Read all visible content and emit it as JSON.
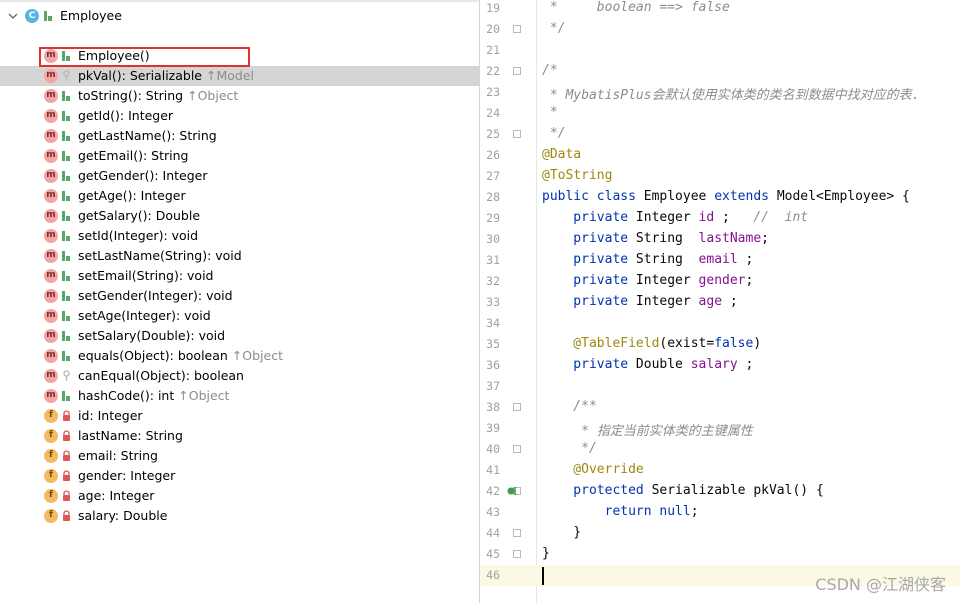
{
  "structure": {
    "root": {
      "label": "Employee",
      "icon": "class-icon"
    },
    "members": [
      {
        "kind": "method",
        "name": "Employee()",
        "suffix": "",
        "access": "public"
      },
      {
        "kind": "method",
        "name": "pkVal(): Serializable",
        "suffix": "↑Model",
        "access": "protected",
        "selected": true
      },
      {
        "kind": "method",
        "name": "toString(): String",
        "suffix": "↑Object",
        "access": "public"
      },
      {
        "kind": "method",
        "name": "getId(): Integer",
        "suffix": "",
        "access": "public"
      },
      {
        "kind": "method",
        "name": "getLastName(): String",
        "suffix": "",
        "access": "public"
      },
      {
        "kind": "method",
        "name": "getEmail(): String",
        "suffix": "",
        "access": "public"
      },
      {
        "kind": "method",
        "name": "getGender(): Integer",
        "suffix": "",
        "access": "public"
      },
      {
        "kind": "method",
        "name": "getAge(): Integer",
        "suffix": "",
        "access": "public"
      },
      {
        "kind": "method",
        "name": "getSalary(): Double",
        "suffix": "",
        "access": "public"
      },
      {
        "kind": "method",
        "name": "setId(Integer): void",
        "suffix": "",
        "access": "public"
      },
      {
        "kind": "method",
        "name": "setLastName(String): void",
        "suffix": "",
        "access": "public"
      },
      {
        "kind": "method",
        "name": "setEmail(String): void",
        "suffix": "",
        "access": "public"
      },
      {
        "kind": "method",
        "name": "setGender(Integer): void",
        "suffix": "",
        "access": "public"
      },
      {
        "kind": "method",
        "name": "setAge(Integer): void",
        "suffix": "",
        "access": "public"
      },
      {
        "kind": "method",
        "name": "setSalary(Double): void",
        "suffix": "",
        "access": "public"
      },
      {
        "kind": "method",
        "name": "equals(Object): boolean",
        "suffix": "↑Object",
        "access": "public"
      },
      {
        "kind": "method",
        "name": "canEqual(Object): boolean",
        "suffix": "",
        "access": "protected"
      },
      {
        "kind": "method",
        "name": "hashCode(): int",
        "suffix": "↑Object",
        "access": "public"
      },
      {
        "kind": "field",
        "name": "id: Integer",
        "suffix": "",
        "access": "private"
      },
      {
        "kind": "field",
        "name": "lastName: String",
        "suffix": "",
        "access": "private"
      },
      {
        "kind": "field",
        "name": "email: String",
        "suffix": "",
        "access": "private"
      },
      {
        "kind": "field",
        "name": "gender: Integer",
        "suffix": "",
        "access": "private"
      },
      {
        "kind": "field",
        "name": "age: Integer",
        "suffix": "",
        "access": "private"
      },
      {
        "kind": "field",
        "name": "salary: Double",
        "suffix": "",
        "access": "private"
      }
    ]
  },
  "editor": {
    "lines": [
      {
        "n": "19",
        "fold": false,
        "t": [
          [
            "cm",
            " *     boolean ==> false"
          ]
        ]
      },
      {
        "n": "20",
        "fold": true,
        "t": [
          [
            "cm",
            " */"
          ]
        ]
      },
      {
        "n": "21",
        "fold": false,
        "t": []
      },
      {
        "n": "22",
        "fold": true,
        "t": [
          [
            "cm",
            "/*"
          ]
        ]
      },
      {
        "n": "23",
        "fold": false,
        "t": [
          [
            "cm",
            " * MybatisPlus会默认使用实体类的类名到数据中找对应的表."
          ]
        ]
      },
      {
        "n": "24",
        "fold": false,
        "t": [
          [
            "cm",
            " *"
          ]
        ]
      },
      {
        "n": "25",
        "fold": true,
        "t": [
          [
            "cm",
            " */"
          ]
        ]
      },
      {
        "n": "26",
        "fold": false,
        "t": [
          [
            "an",
            "@Data"
          ]
        ]
      },
      {
        "n": "27",
        "fold": false,
        "t": [
          [
            "an",
            "@ToString"
          ]
        ]
      },
      {
        "n": "28",
        "fold": false,
        "t": [
          [
            "kw",
            "public class "
          ],
          [
            "",
            "Employee "
          ],
          [
            "kw",
            "extends "
          ],
          [
            "",
            "Model<Employee> {"
          ]
        ]
      },
      {
        "n": "29",
        "fold": false,
        "t": [
          [
            "kw",
            "    private "
          ],
          [
            "",
            "Integer "
          ],
          [
            "fd",
            "id"
          ],
          [
            "",
            " ;   "
          ],
          [
            "cm",
            "//  int"
          ]
        ]
      },
      {
        "n": "30",
        "fold": false,
        "t": [
          [
            "kw",
            "    private "
          ],
          [
            "",
            "String  "
          ],
          [
            "fd",
            "lastName"
          ],
          [
            "",
            ";"
          ]
        ]
      },
      {
        "n": "31",
        "fold": false,
        "t": [
          [
            "kw",
            "    private "
          ],
          [
            "",
            "String  "
          ],
          [
            "fd",
            "email"
          ],
          [
            "",
            " ;"
          ]
        ]
      },
      {
        "n": "32",
        "fold": false,
        "t": [
          [
            "kw",
            "    private "
          ],
          [
            "",
            "Integer "
          ],
          [
            "fd",
            "gender"
          ],
          [
            "",
            ";"
          ]
        ]
      },
      {
        "n": "33",
        "fold": false,
        "t": [
          [
            "kw",
            "    private "
          ],
          [
            "",
            "Integer "
          ],
          [
            "fd",
            "age"
          ],
          [
            "",
            " ;"
          ]
        ]
      },
      {
        "n": "34",
        "fold": false,
        "t": []
      },
      {
        "n": "35",
        "fold": false,
        "t": [
          [
            "an",
            "    @TableField"
          ],
          [
            "",
            "(exist="
          ],
          [
            "kw",
            "false"
          ],
          [
            "",
            ")"
          ]
        ]
      },
      {
        "n": "36",
        "fold": false,
        "t": [
          [
            "kw",
            "    private "
          ],
          [
            "",
            "Double "
          ],
          [
            "fd",
            "salary"
          ],
          [
            "",
            " ;"
          ]
        ]
      },
      {
        "n": "37",
        "fold": false,
        "t": []
      },
      {
        "n": "38",
        "fold": true,
        "t": [
          [
            "cm",
            "    /**"
          ]
        ]
      },
      {
        "n": "39",
        "fold": false,
        "t": [
          [
            "cm",
            "     * 指定当前实体类的主键属性"
          ]
        ]
      },
      {
        "n": "40",
        "fold": true,
        "t": [
          [
            "cm",
            "     */"
          ]
        ]
      },
      {
        "n": "41",
        "fold": false,
        "t": [
          [
            "an",
            "    @Override"
          ]
        ]
      },
      {
        "n": "42",
        "fold": true,
        "t": [
          [
            "kw",
            "    protected "
          ],
          [
            "",
            "Serializable pkVal() {"
          ]
        ]
      },
      {
        "n": "43",
        "fold": false,
        "t": [
          [
            "kw",
            "        return null"
          ],
          [
            "",
            ";"
          ]
        ]
      },
      {
        "n": "44",
        "fold": true,
        "t": [
          [
            "",
            "    }"
          ]
        ]
      },
      {
        "n": "45",
        "fold": true,
        "t": [
          [
            "",
            "}"
          ]
        ]
      },
      {
        "n": "46",
        "fold": false,
        "t": [],
        "current": true
      }
    ]
  },
  "watermark": "CSDN @江湖侠客",
  "colors": {
    "keyword": "#0033b3",
    "comment": "#8c8c8c",
    "annotation": "#9e880d",
    "field": "#871094",
    "highlight_box": "#e03030"
  }
}
